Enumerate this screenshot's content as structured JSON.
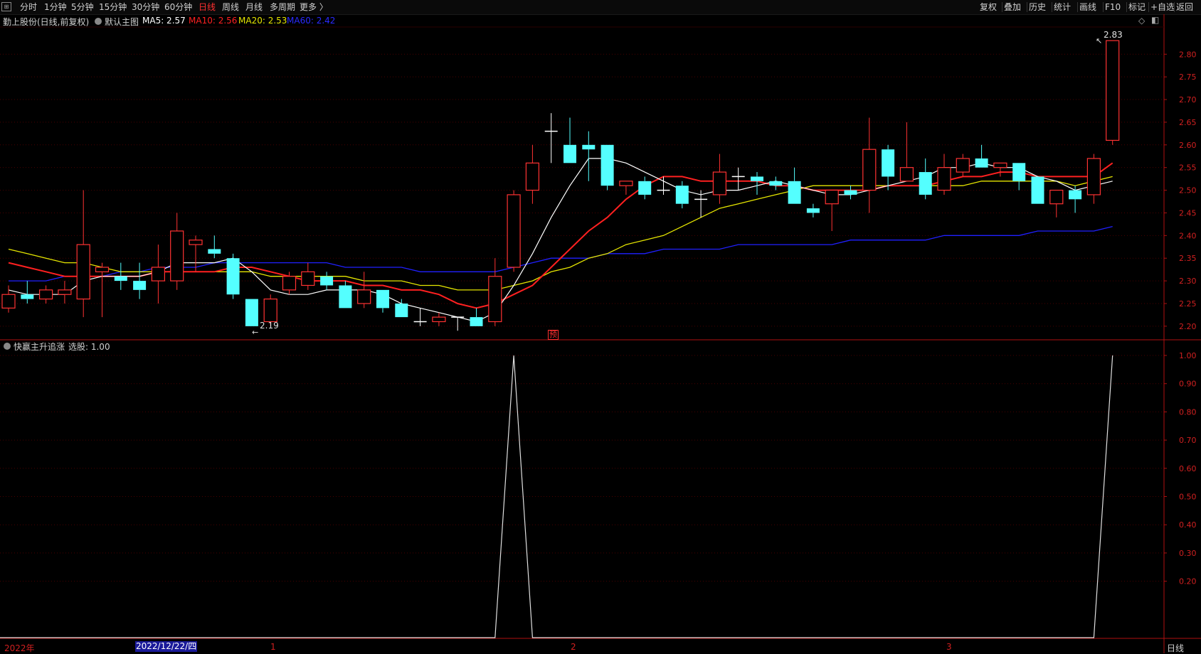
{
  "toolbar": {
    "periods": [
      "分时",
      "1分钟",
      "5分钟",
      "15分钟",
      "30分钟",
      "60分钟",
      "日线",
      "周线",
      "月线",
      "多周期",
      "更多 〉"
    ],
    "active_period": "日线",
    "right_buttons": [
      "复权",
      "叠加",
      "历史",
      "统计",
      "画线",
      "F10",
      "标记",
      "+自选",
      "返回"
    ]
  },
  "main_header": {
    "stock": "勤上股份(日线,前复权)",
    "chart_name": "默认主图",
    "ma5": "MA5: 2.57",
    "ma10": "MA10: 2.56",
    "ma20": "MA20: 2.53",
    "ma60": "MA60: 2.42"
  },
  "indicator_header": {
    "name": "快赢主升追涨",
    "value": "选股: 1.00"
  },
  "price_axis": [
    "2.80",
    "2.75",
    "2.70",
    "2.65",
    "2.60",
    "2.55",
    "2.50",
    "2.45",
    "2.40",
    "2.35",
    "2.30",
    "2.25",
    "2.20"
  ],
  "indicator_axis": [
    "1.00",
    "0.90",
    "0.80",
    "0.70",
    "0.60",
    "0.50",
    "0.40",
    "0.30",
    "0.20"
  ],
  "annotations": {
    "high": "2.83",
    "low": "2.19",
    "marker": "预"
  },
  "date_axis": {
    "year": "2022年",
    "selected_date": "2022/12/22/四",
    "m1": "1",
    "m2": "2",
    "m3": "3",
    "period_label": "日线"
  },
  "colors": {
    "up": "#ff3232",
    "down": "#54ffff",
    "ma5": "#ffffff",
    "ma10": "#ff2020",
    "ma20": "#e6e600",
    "ma60": "#2020ff",
    "grid": "#4a0000"
  },
  "chart_data": {
    "type": "candlestick",
    "ylim": [
      2.17,
      2.86
    ],
    "candles": [
      {
        "o": 2.24,
        "h": 2.29,
        "l": 2.23,
        "c": 2.27
      },
      {
        "o": 2.27,
        "h": 2.3,
        "l": 2.25,
        "c": 2.26
      },
      {
        "o": 2.26,
        "h": 2.29,
        "l": 2.25,
        "c": 2.28
      },
      {
        "o": 2.27,
        "h": 2.3,
        "l": 2.25,
        "c": 2.28
      },
      {
        "o": 2.26,
        "h": 2.5,
        "l": 2.22,
        "c": 2.38
      },
      {
        "o": 2.32,
        "h": 2.34,
        "l": 2.22,
        "c": 2.33
      },
      {
        "o": 2.31,
        "h": 2.34,
        "l": 2.28,
        "c": 2.3
      },
      {
        "o": 2.3,
        "h": 2.34,
        "l": 2.26,
        "c": 2.28
      },
      {
        "o": 2.3,
        "h": 2.38,
        "l": 2.25,
        "c": 2.33
      },
      {
        "o": 2.3,
        "h": 2.45,
        "l": 2.28,
        "c": 2.41
      },
      {
        "o": 2.38,
        "h": 2.4,
        "l": 2.32,
        "c": 2.39
      },
      {
        "o": 2.37,
        "h": 2.4,
        "l": 2.35,
        "c": 2.36
      },
      {
        "o": 2.35,
        "h": 2.36,
        "l": 2.26,
        "c": 2.27
      },
      {
        "o": 2.26,
        "h": 2.26,
        "l": 2.2,
        "c": 2.2
      },
      {
        "o": 2.21,
        "h": 2.27,
        "l": 2.2,
        "c": 2.26
      },
      {
        "o": 2.28,
        "h": 2.32,
        "l": 2.27,
        "c": 2.31
      },
      {
        "o": 2.29,
        "h": 2.34,
        "l": 2.28,
        "c": 2.32
      },
      {
        "o": 2.31,
        "h": 2.32,
        "l": 2.28,
        "c": 2.29
      },
      {
        "o": 2.29,
        "h": 2.3,
        "l": 2.24,
        "c": 2.24
      },
      {
        "o": 2.25,
        "h": 2.32,
        "l": 2.24,
        "c": 2.28
      },
      {
        "o": 2.28,
        "h": 2.28,
        "l": 2.23,
        "c": 2.24
      },
      {
        "o": 2.25,
        "h": 2.26,
        "l": 2.22,
        "c": 2.22
      },
      {
        "o": 2.21,
        "h": 2.24,
        "l": 2.2,
        "c": 2.21
      },
      {
        "o": 2.21,
        "h": 2.23,
        "l": 2.2,
        "c": 2.22
      },
      {
        "o": 2.22,
        "h": 2.22,
        "l": 2.19,
        "c": 2.22
      },
      {
        "o": 2.22,
        "h": 2.24,
        "l": 2.2,
        "c": 2.2
      },
      {
        "o": 2.21,
        "h": 2.35,
        "l": 2.2,
        "c": 2.31
      },
      {
        "o": 2.33,
        "h": 2.5,
        "l": 2.32,
        "c": 2.49
      },
      {
        "o": 2.5,
        "h": 2.6,
        "l": 2.47,
        "c": 2.56
      },
      {
        "o": 2.63,
        "h": 2.67,
        "l": 2.56,
        "c": 2.63
      },
      {
        "o": 2.6,
        "h": 2.66,
        "l": 2.56,
        "c": 2.56
      },
      {
        "o": 2.6,
        "h": 2.63,
        "l": 2.52,
        "c": 2.59
      },
      {
        "o": 2.6,
        "h": 2.6,
        "l": 2.5,
        "c": 2.51
      },
      {
        "o": 2.51,
        "h": 2.52,
        "l": 2.49,
        "c": 2.52
      },
      {
        "o": 2.52,
        "h": 2.53,
        "l": 2.48,
        "c": 2.49
      },
      {
        "o": 2.5,
        "h": 2.53,
        "l": 2.49,
        "c": 2.5
      },
      {
        "o": 2.51,
        "h": 2.52,
        "l": 2.46,
        "c": 2.47
      },
      {
        "o": 2.48,
        "h": 2.5,
        "l": 2.44,
        "c": 2.48
      },
      {
        "o": 2.49,
        "h": 2.58,
        "l": 2.47,
        "c": 2.54
      },
      {
        "o": 2.53,
        "h": 2.55,
        "l": 2.5,
        "c": 2.53
      },
      {
        "o": 2.53,
        "h": 2.54,
        "l": 2.49,
        "c": 2.52
      },
      {
        "o": 2.52,
        "h": 2.53,
        "l": 2.5,
        "c": 2.51
      },
      {
        "o": 2.52,
        "h": 2.55,
        "l": 2.47,
        "c": 2.47
      },
      {
        "o": 2.46,
        "h": 2.47,
        "l": 2.44,
        "c": 2.45
      },
      {
        "o": 2.47,
        "h": 2.49,
        "l": 2.41,
        "c": 2.5
      },
      {
        "o": 2.5,
        "h": 2.51,
        "l": 2.48,
        "c": 2.49
      },
      {
        "o": 2.5,
        "h": 2.66,
        "l": 2.45,
        "c": 2.59
      },
      {
        "o": 2.59,
        "h": 2.6,
        "l": 2.5,
        "c": 2.53
      },
      {
        "o": 2.52,
        "h": 2.65,
        "l": 2.52,
        "c": 2.55
      },
      {
        "o": 2.54,
        "h": 2.57,
        "l": 2.48,
        "c": 2.49
      },
      {
        "o": 2.5,
        "h": 2.58,
        "l": 2.49,
        "c": 2.55
      },
      {
        "o": 2.54,
        "h": 2.58,
        "l": 2.53,
        "c": 2.57
      },
      {
        "o": 2.57,
        "h": 2.6,
        "l": 2.55,
        "c": 2.55
      },
      {
        "o": 2.55,
        "h": 2.56,
        "l": 2.53,
        "c": 2.56
      },
      {
        "o": 2.56,
        "h": 2.56,
        "l": 2.5,
        "c": 2.52
      },
      {
        "o": 2.53,
        "h": 2.53,
        "l": 2.47,
        "c": 2.47
      },
      {
        "o": 2.47,
        "h": 2.5,
        "l": 2.44,
        "c": 2.5
      },
      {
        "o": 2.5,
        "h": 2.51,
        "l": 2.45,
        "c": 2.48
      },
      {
        "o": 2.49,
        "h": 2.58,
        "l": 2.47,
        "c": 2.57
      },
      {
        "o": 2.61,
        "h": 2.83,
        "l": 2.6,
        "c": 2.83
      }
    ],
    "ma5": [
      2.28,
      2.27,
      2.27,
      2.27,
      2.3,
      2.31,
      2.31,
      2.31,
      2.32,
      2.34,
      2.34,
      2.34,
      2.35,
      2.32,
      2.28,
      2.27,
      2.27,
      2.28,
      2.28,
      2.28,
      2.27,
      2.25,
      2.24,
      2.23,
      2.22,
      2.21,
      2.23,
      2.29,
      2.36,
      2.44,
      2.51,
      2.57,
      2.57,
      2.56,
      2.54,
      2.52,
      2.5,
      2.49,
      2.5,
      2.5,
      2.51,
      2.52,
      2.51,
      2.5,
      2.49,
      2.49,
      2.5,
      2.51,
      2.52,
      2.53,
      2.55,
      2.55,
      2.56,
      2.55,
      2.55,
      2.53,
      2.52,
      2.5,
      2.51,
      2.52
    ],
    "ma10": [
      2.34,
      2.33,
      2.32,
      2.31,
      2.31,
      2.31,
      2.31,
      2.31,
      2.32,
      2.32,
      2.32,
      2.32,
      2.33,
      2.33,
      2.32,
      2.31,
      2.3,
      2.3,
      2.3,
      2.29,
      2.29,
      2.28,
      2.28,
      2.27,
      2.25,
      2.24,
      2.25,
      2.27,
      2.29,
      2.33,
      2.37,
      2.41,
      2.44,
      2.48,
      2.51,
      2.53,
      2.53,
      2.52,
      2.52,
      2.52,
      2.52,
      2.51,
      2.51,
      2.5,
      2.5,
      2.5,
      2.5,
      2.51,
      2.51,
      2.51,
      2.52,
      2.53,
      2.53,
      2.54,
      2.54,
      2.53,
      2.53,
      2.53,
      2.53,
      2.56
    ],
    "ma20": [
      2.37,
      2.36,
      2.35,
      2.34,
      2.34,
      2.33,
      2.32,
      2.32,
      2.32,
      2.32,
      2.32,
      2.32,
      2.32,
      2.32,
      2.31,
      2.31,
      2.31,
      2.31,
      2.31,
      2.3,
      2.3,
      2.3,
      2.29,
      2.29,
      2.28,
      2.28,
      2.28,
      2.29,
      2.3,
      2.32,
      2.33,
      2.35,
      2.36,
      2.38,
      2.39,
      2.4,
      2.42,
      2.44,
      2.46,
      2.47,
      2.48,
      2.49,
      2.5,
      2.51,
      2.51,
      2.51,
      2.51,
      2.51,
      2.51,
      2.51,
      2.51,
      2.51,
      2.52,
      2.52,
      2.52,
      2.52,
      2.52,
      2.51,
      2.52,
      2.53
    ],
    "ma60": [
      2.3,
      2.3,
      2.3,
      2.31,
      2.31,
      2.31,
      2.32,
      2.32,
      2.33,
      2.33,
      2.33,
      2.34,
      2.34,
      2.34,
      2.34,
      2.34,
      2.34,
      2.34,
      2.33,
      2.33,
      2.33,
      2.33,
      2.32,
      2.32,
      2.32,
      2.32,
      2.32,
      2.33,
      2.34,
      2.35,
      2.35,
      2.35,
      2.36,
      2.36,
      2.36,
      2.37,
      2.37,
      2.37,
      2.37,
      2.38,
      2.38,
      2.38,
      2.38,
      2.38,
      2.38,
      2.39,
      2.39,
      2.39,
      2.39,
      2.39,
      2.4,
      2.4,
      2.4,
      2.4,
      2.4,
      2.41,
      2.41,
      2.41,
      2.41,
      2.42
    ],
    "signal": [
      0,
      0,
      0,
      0,
      0,
      0,
      0,
      0,
      0,
      0,
      0,
      0,
      0,
      0,
      0,
      0,
      0,
      0,
      0,
      0,
      0,
      0,
      0,
      0,
      0,
      0,
      0,
      1,
      0,
      0,
      0,
      0,
      0,
      0,
      0,
      0,
      0,
      0,
      0,
      0,
      0,
      0,
      0,
      0,
      0,
      0,
      0,
      0,
      0,
      0,
      0,
      0,
      0,
      0,
      0,
      0,
      0,
      0,
      0,
      1
    ]
  }
}
